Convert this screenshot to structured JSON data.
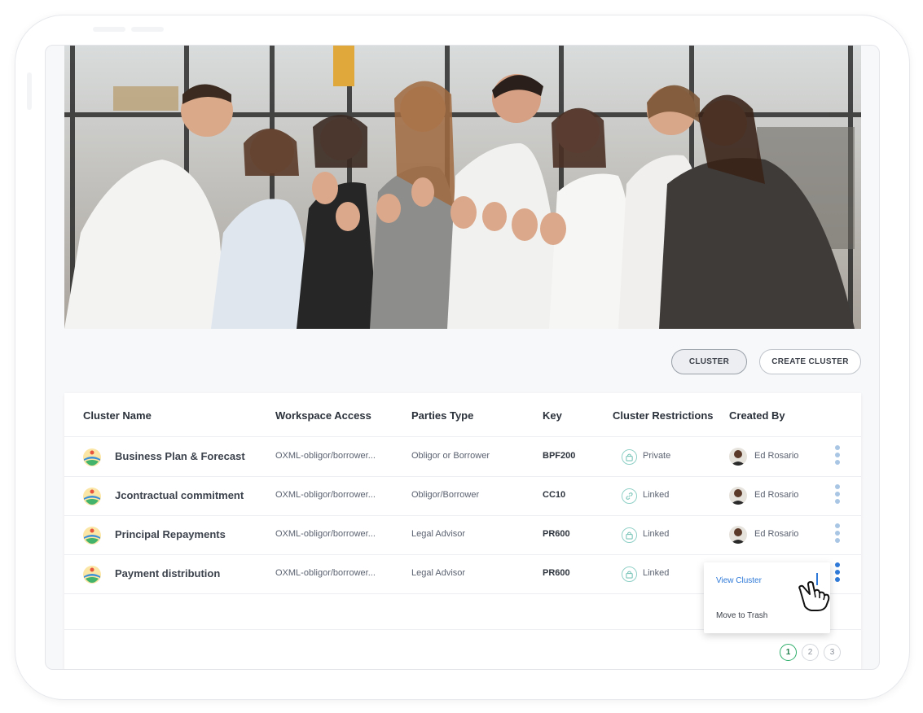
{
  "hero": {
    "image_alt": "Team of coworkers giving thumbs up"
  },
  "actions": {
    "cluster_label": "CLUSTER",
    "create_cluster_label": "CREATE CLUSTER"
  },
  "table": {
    "columns": [
      "Cluster Name",
      "Workspace Access",
      "Parties Type",
      "Key",
      "Cluster Restrictions",
      "Created By"
    ],
    "rows": [
      {
        "name": "Business Plan & Forecast",
        "workspace": "OXML-obligor/borrower...",
        "parties": "Obligor or Borrower",
        "key": "BPF200",
        "restriction": "Private",
        "restriction_icon": "lock-icon",
        "created_by": "Ed Rosario"
      },
      {
        "name": "Jcontractual commitment",
        "workspace": "OXML-obligor/borrower...",
        "parties": "Obligor/Borrower",
        "key": "CC10",
        "restriction": "Linked",
        "restriction_icon": "link-icon",
        "created_by": "Ed Rosario"
      },
      {
        "name": "Principal Repayments",
        "workspace": "OXML-obligor/borrower...",
        "parties": "Legal Advisor",
        "key": "PR600",
        "restriction": "Linked",
        "restriction_icon": "lock-icon",
        "created_by": "Ed Rosario"
      },
      {
        "name": "Payment distribution",
        "workspace": "OXML-obligor/borrower...",
        "parties": "Legal Advisor",
        "key": "PR600",
        "restriction": "Linked",
        "restriction_icon": "lock-icon",
        "created_by": ""
      }
    ]
  },
  "context_menu": {
    "view_label": "View Cluster",
    "trash_label": "Move to Trash"
  },
  "pagination": {
    "pages": [
      "1",
      "2",
      "3"
    ],
    "current": "1"
  },
  "colors": {
    "accent": "#2f7ad8",
    "pager_active": "#2fae6a",
    "restriction_ring": "#8fd0c6"
  }
}
